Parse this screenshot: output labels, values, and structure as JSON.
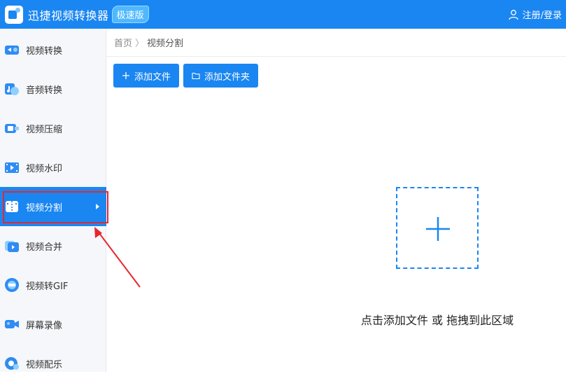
{
  "app": {
    "title": "迅捷视频转换器",
    "badge": "极速版",
    "login_label": "注册/登录"
  },
  "sidebar": {
    "items": [
      {
        "label": "视频转换",
        "icon": "video-convert-icon"
      },
      {
        "label": "音频转换",
        "icon": "audio-convert-icon"
      },
      {
        "label": "视频压缩",
        "icon": "video-compress-icon"
      },
      {
        "label": "视频水印",
        "icon": "video-watermark-icon"
      },
      {
        "label": "视频分割",
        "icon": "video-split-icon",
        "active": true
      },
      {
        "label": "视频合并",
        "icon": "video-merge-icon"
      },
      {
        "label": "视频转GIF",
        "icon": "video-to-gif-icon"
      },
      {
        "label": "屏幕录像",
        "icon": "screen-record-icon"
      },
      {
        "label": "视频配乐",
        "icon": "video-music-icon"
      }
    ]
  },
  "breadcrumb": {
    "home": "首页",
    "separator": "〉",
    "current": "视频分割"
  },
  "toolbar": {
    "add_file_label": "添加文件",
    "add_folder_label": "添加文件夹"
  },
  "dropzone": {
    "hint": "点击添加文件 或 拖拽到此区域"
  },
  "colors": {
    "accent": "#1a86f1",
    "highlight": "#e8262c",
    "sidebar_bg": "#f5f7fa"
  }
}
